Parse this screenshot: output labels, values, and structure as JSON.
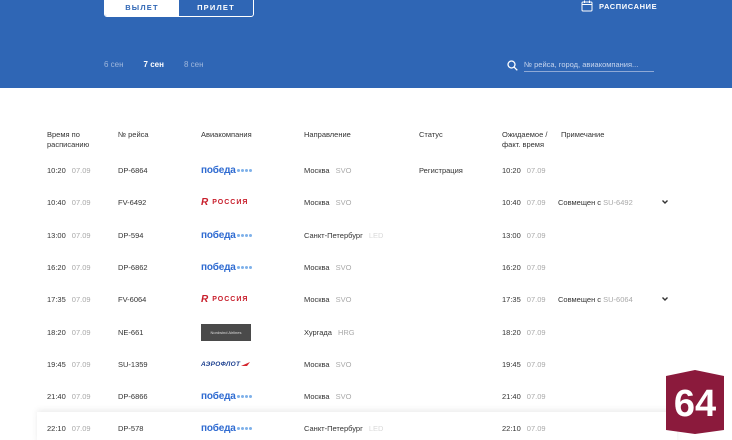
{
  "header": {
    "toggle": {
      "departure": "ВЫЛЕТ",
      "arrival": "ПРИЛЕТ"
    },
    "schedule_label": "РАСПИСАНИЕ",
    "dates": [
      {
        "label": "6 сен",
        "active": false
      },
      {
        "label": "7 сен",
        "active": true
      },
      {
        "label": "8 сен",
        "active": false
      }
    ],
    "search": {
      "placeholder": "№ рейса, город, авиакомпания..."
    },
    "brand_color": "#2f66b5"
  },
  "table": {
    "columns": {
      "scheduled": "Время по\nрасписанию",
      "flight": "№ рейса",
      "airline": "Авиакомпания",
      "direction": "Направление",
      "status": "Статус",
      "expected": "Ожидаемое /\nфакт. время",
      "note": "Примечание"
    },
    "rows": [
      {
        "time": "10:20",
        "date": "07.09",
        "flight": "DP-6864",
        "airline": "pobeda",
        "city": "Москва",
        "code": "SVO",
        "status": "Регистрация",
        "exp_time": "10:20",
        "exp_date": "07.09",
        "note": "",
        "chevron": false
      },
      {
        "time": "10:40",
        "date": "07.09",
        "flight": "FV-6492",
        "airline": "rossiya",
        "city": "Москва",
        "code": "SVO",
        "status": "",
        "exp_time": "10:40",
        "exp_date": "07.09",
        "note": "Совмещен с SU-6492",
        "chevron": true
      },
      {
        "time": "13:00",
        "date": "07.09",
        "flight": "DP-594",
        "airline": "pobeda",
        "city": "Санкт-Петербург",
        "code": "LED",
        "status": "",
        "exp_time": "13:00",
        "exp_date": "07.09",
        "note": "",
        "chevron": false
      },
      {
        "time": "16:20",
        "date": "07.09",
        "flight": "DP-6862",
        "airline": "pobeda",
        "city": "Москва",
        "code": "SVO",
        "status": "",
        "exp_time": "16:20",
        "exp_date": "07.09",
        "note": "",
        "chevron": false
      },
      {
        "time": "17:35",
        "date": "07.09",
        "flight": "FV-6064",
        "airline": "rossiya",
        "city": "Москва",
        "code": "SVO",
        "status": "",
        "exp_time": "17:35",
        "exp_date": "07.09",
        "note": "Совмещен с SU-6064",
        "chevron": true
      },
      {
        "time": "18:20",
        "date": "07.09",
        "flight": "NE-661",
        "airline": "nordwind",
        "city": "Хургада",
        "code": "HRG",
        "status": "",
        "exp_time": "18:20",
        "exp_date": "07.09",
        "note": "",
        "chevron": false
      },
      {
        "time": "19:45",
        "date": "07.09",
        "flight": "SU-1359",
        "airline": "aeroflot",
        "city": "Москва",
        "code": "SVO",
        "status": "",
        "exp_time": "19:45",
        "exp_date": "07.09",
        "note": "",
        "chevron": false
      },
      {
        "time": "21:40",
        "date": "07.09",
        "flight": "DP-6866",
        "airline": "pobeda",
        "city": "Москва",
        "code": "SVO",
        "status": "",
        "exp_time": "21:40",
        "exp_date": "07.09",
        "note": "",
        "chevron": false
      },
      {
        "time": "22:10",
        "date": "07.09",
        "flight": "DP-578",
        "airline": "pobeda",
        "city": "Санкт-Петербург",
        "code": "LED",
        "status": "",
        "exp_time": "22:10",
        "exp_date": "07.09",
        "note": "",
        "chevron": false
      }
    ]
  },
  "logos": {
    "pobeda": "победа",
    "rossiya": "РОССИЯ",
    "nordwind": "Nordwind Airlines",
    "aeroflot": "АЭРОФЛОТ"
  },
  "badge": {
    "text": "64",
    "color": "#8b1a3c"
  }
}
